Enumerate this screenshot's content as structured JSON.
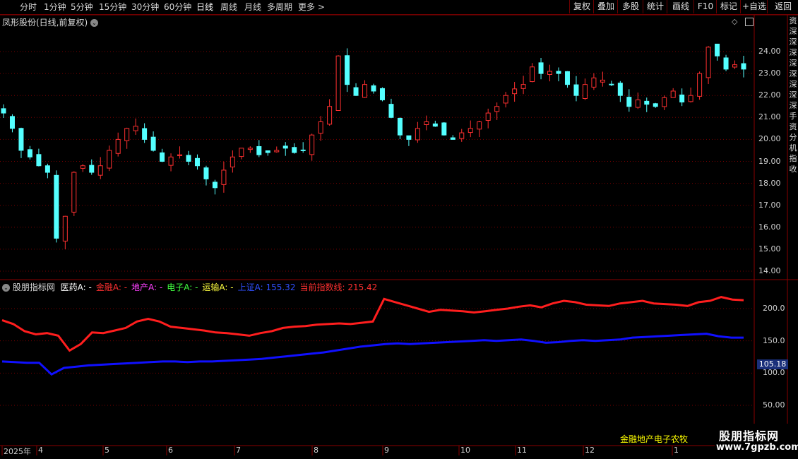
{
  "toolbar": {
    "tabs": [
      {
        "label": "分时"
      },
      {
        "label": "1分钟"
      },
      {
        "label": "5分钟"
      },
      {
        "label": "15分钟"
      },
      {
        "label": "30分钟"
      },
      {
        "label": "60分钟"
      },
      {
        "label": "日线"
      },
      {
        "label": "周线"
      },
      {
        "label": "月线"
      },
      {
        "label": "多周期"
      },
      {
        "label": "更多 >"
      }
    ],
    "right_buttons": [
      {
        "label": "复权"
      },
      {
        "label": "叠加"
      },
      {
        "label": "多股"
      },
      {
        "label": "统计"
      },
      {
        "label": "画线"
      },
      {
        "label": "F10"
      },
      {
        "label": "标记"
      },
      {
        "label": "+自选"
      },
      {
        "label": "返回"
      }
    ],
    "active_tab": "日线"
  },
  "main_panel": {
    "title": "凤形股份(日线,前复权)",
    "y_ticks": [
      "24.00",
      "23.00",
      "22.00",
      "21.00",
      "20.00",
      "19.00",
      "18.00",
      "17.00",
      "16.00",
      "15.00",
      "14.00"
    ]
  },
  "sub_panel": {
    "title": "股朋指标网",
    "legend": [
      {
        "label": "医药A: -",
        "color": "#ffffff"
      },
      {
        "label": "金融A: -",
        "color": "#ff3030"
      },
      {
        "label": "地产A: -",
        "color": "#ff40ff"
      },
      {
        "label": "电子A: -",
        "color": "#40ff40"
      },
      {
        "label": "运输A: -",
        "color": "#ffff40"
      },
      {
        "label": "上证A: 155.32",
        "color": "#3050ff"
      },
      {
        "label": "当前指数线: 215.42",
        "color": "#ff3030"
      }
    ],
    "y_ticks": [
      "200.0",
      "150.0",
      "100.0",
      "50.00"
    ],
    "current_tag": "105.18",
    "bottom_text": "金融地产电子农牧"
  },
  "x_axis": {
    "labels": [
      "2025年",
      "4",
      "5",
      "6",
      "7",
      "8",
      "9",
      "10",
      "11",
      "12",
      "1"
    ]
  },
  "right_strip": [
    "资",
    "深",
    "深",
    "深",
    "深",
    "深",
    "深",
    "深",
    "深",
    "手",
    "资",
    "分",
    "机",
    "指",
    "收"
  ],
  "watermark": {
    "line1": "股朋指标网",
    "line2": "www.7gpzb.com"
  },
  "colors": {
    "up": "#ff3030",
    "down": "#54ffff",
    "grid": "#8a0000",
    "blue_line": "#1010ff",
    "red_line": "#ff1e1e"
  },
  "chart_data": [
    {
      "type": "candlestick",
      "title": "凤形股份(日线,前复权)",
      "ylim": [
        14,
        25
      ],
      "close_approx": [
        21.2,
        20.5,
        19.5,
        19.2,
        18.8,
        18.5,
        15.5,
        16.5,
        18.5,
        18.8,
        18.5,
        18.8,
        19.5,
        20.0,
        20.5,
        20.6,
        20.0,
        19.5,
        19.0,
        19.2,
        19.3,
        19.0,
        18.8,
        18.2,
        17.8,
        18.6,
        19.2,
        19.6,
        19.6,
        19.3,
        19.4,
        19.5,
        19.6,
        19.4,
        19.5,
        20.2,
        20.8,
        21.5,
        23.8,
        22.5,
        22.0,
        22.5,
        22.2,
        21.8,
        21.0,
        20.2,
        20.0,
        20.5,
        20.8,
        20.6,
        20.2,
        20.0,
        20.3,
        20.5,
        20.8,
        21.2,
        21.5,
        22.0,
        22.3,
        22.5,
        23.3,
        23.0,
        23.1,
        23.0,
        22.5,
        22.0,
        22.5,
        22.8,
        22.7,
        22.5,
        22.0,
        21.5,
        21.8,
        21.6,
        21.5,
        21.9,
        22.2,
        21.7,
        22.0,
        23.0,
        24.2,
        23.8,
        23.2,
        23.4,
        23.2
      ]
    },
    {
      "type": "line",
      "series": [
        {
          "name": "当前指数线",
          "color": "#ff1e1e",
          "values": [
            182,
            176,
            165,
            160,
            162,
            158,
            135,
            145,
            163,
            162,
            166,
            170,
            180,
            184,
            180,
            172,
            170,
            168,
            166,
            163,
            162,
            160,
            158,
            162,
            165,
            170,
            172,
            173,
            175,
            176,
            177,
            176,
            178,
            180,
            215,
            210,
            205,
            200,
            195,
            198,
            197,
            196,
            194,
            196,
            198,
            200,
            203,
            205,
            202,
            208,
            212,
            210,
            206,
            205,
            204,
            208,
            210,
            212,
            208,
            207,
            206,
            204,
            210,
            212,
            218,
            214,
            213
          ]
        },
        {
          "name": "上证A",
          "color": "#1010ff",
          "values": [
            118,
            117,
            116,
            116,
            98,
            108,
            110,
            112,
            113,
            114,
            115,
            116,
            117,
            118,
            118,
            117,
            118,
            118,
            119,
            120,
            121,
            122,
            124,
            126,
            128,
            130,
            132,
            135,
            138,
            141,
            143,
            145,
            146,
            145,
            146,
            147,
            148,
            149,
            150,
            151,
            150,
            151,
            152,
            150,
            147,
            148,
            150,
            151,
            150,
            151,
            152,
            155,
            156,
            157,
            158,
            159,
            160,
            161,
            157,
            155,
            155
          ]
        }
      ],
      "y_ticks": [
        50,
        100,
        150,
        200
      ],
      "ylim": [
        25,
        235
      ]
    }
  ]
}
